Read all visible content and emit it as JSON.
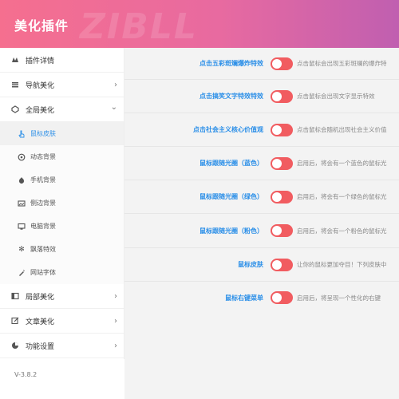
{
  "header": {
    "title": "美化插件",
    "watermark": "ZIBLL"
  },
  "sidebar": {
    "items": [
      {
        "label": "插件详情",
        "icon": "plugin-icon"
      },
      {
        "label": "导航美化",
        "icon": "navigation-icon",
        "chevron": "›"
      },
      {
        "label": "全局美化",
        "icon": "global-icon",
        "chevron": "⌄"
      },
      {
        "label": "局部美化",
        "icon": "local-icon",
        "chevron": "›"
      },
      {
        "label": "文章美化",
        "icon": "article-icon",
        "chevron": "›"
      },
      {
        "label": "功能设置",
        "icon": "settings-icon",
        "chevron": "›"
      }
    ],
    "subitems": [
      {
        "label": "鼠标皮肤",
        "icon": "hand-pointer-icon",
        "active": true
      },
      {
        "label": "动态背景",
        "icon": "dynamic-bg-icon"
      },
      {
        "label": "手机背景",
        "icon": "mobile-bg-icon"
      },
      {
        "label": "侧边背景",
        "icon": "side-bg-icon"
      },
      {
        "label": "电脑背景",
        "icon": "desktop-bg-icon"
      },
      {
        "label": "飘落特效",
        "icon": "snowflake-icon"
      },
      {
        "label": "网站字体",
        "icon": "font-icon"
      }
    ]
  },
  "footer": {
    "version": "V-3.8.2"
  },
  "settings": [
    {
      "label": "点击五彩斑斓爆炸特效",
      "desc": "点击鼠标会出现五彩斑斓的爆炸特"
    },
    {
      "label": "点击搞笑文字特效特效",
      "desc": "点击鼠标会出现文字显示特效"
    },
    {
      "label": "点击社会主义核心价值观",
      "desc": "点击鼠标会随机出现社会主义价值"
    },
    {
      "label": "鼠标跟随光圈（蓝色）",
      "desc": "启用后，将会有一个蓝色的鼠标光"
    },
    {
      "label": "鼠标跟随光圈（绿色）",
      "desc": "启用后，将会有一个绿色的鼠标光"
    },
    {
      "label": "鼠标跟随光圈（粉色）",
      "desc": "启用后，将会有一个粉色的鼠标光"
    },
    {
      "label": "鼠标皮肤",
      "desc": "让你的鼠标更加夺目！下列皮肤中"
    },
    {
      "label": "鼠标右键菜单",
      "desc": "启用后，将呈现一个性化的右键"
    }
  ],
  "colors": {
    "accent": "#2b8fe8",
    "toggle_on": "#f15c60",
    "header_start": "#f56f8f",
    "header_end": "#c05fb0"
  }
}
